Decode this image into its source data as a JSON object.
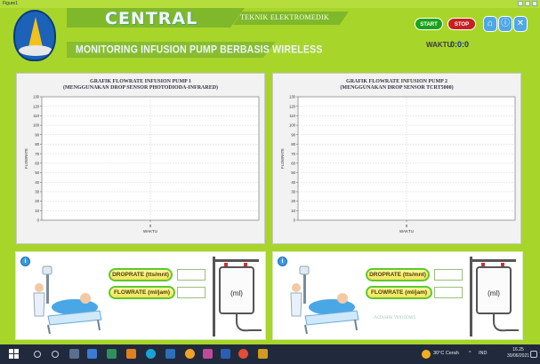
{
  "window": {
    "title": "Figure1"
  },
  "header": {
    "brand": "CENTRAL",
    "department": "TEKNIK ELEKTROMEDIK",
    "subtitle": "MONITORING INFUSION PUMP BERBASIS WIRELESS",
    "start_label": "START",
    "stop_label": "STOP",
    "time_label": "WAKTU",
    "time_value": "0:0:0"
  },
  "chart_data": [
    {
      "type": "line",
      "title": "GRAFIK FLOWRATE INFUSION PUMP 1",
      "subtitle": "(MENGGUNAKAN DROP SENSOR PHOTODIODA-INFRARED)",
      "xlabel": "WAKTU",
      "ylabel": "FLOWRATE",
      "x_ticks": [
        "0"
      ],
      "y_ticks": [
        0,
        10,
        20,
        30,
        40,
        50,
        60,
        70,
        80,
        90,
        100,
        110,
        120,
        130
      ],
      "ylim": [
        0,
        130
      ],
      "grid": true,
      "series": []
    },
    {
      "type": "line",
      "title": "GRAFIK FLOWRATE INFUSION PUMP 2",
      "subtitle": "(MENGGUNAKAN DROP SENSOR TCRT5000)",
      "xlabel": "WAKTU",
      "ylabel": "FLOWRATE",
      "x_ticks": [
        "0"
      ],
      "y_ticks": [
        0,
        10,
        20,
        30,
        40,
        50,
        60,
        70,
        80,
        90,
        100,
        110,
        120,
        130
      ],
      "ylim": [
        0,
        130
      ],
      "grid": true,
      "series": []
    }
  ],
  "pump1": {
    "droprate_label": "DROPRATE (tts/mnt)",
    "flowrate_label": "FLOWRATE (ml/jam)",
    "droprate_value": "",
    "flowrate_value": "",
    "bag_label": "(ml)"
  },
  "pump2": {
    "droprate_label": "DROPRATE (tts/mnt)",
    "flowrate_label": "FLOWRATE (ml/jam)",
    "droprate_value": "",
    "flowrate_value": "",
    "bag_label": "(ml)"
  },
  "watermark": "Activate Windows",
  "taskbar": {
    "weather": "30°C Cerah",
    "language": "IND",
    "time": "16.25",
    "date": "30/06/2021"
  },
  "colors": {
    "background": "#a8d52a",
    "start": "#1ca11c",
    "stop": "#c82020",
    "pill_border": "#5ec82e"
  }
}
